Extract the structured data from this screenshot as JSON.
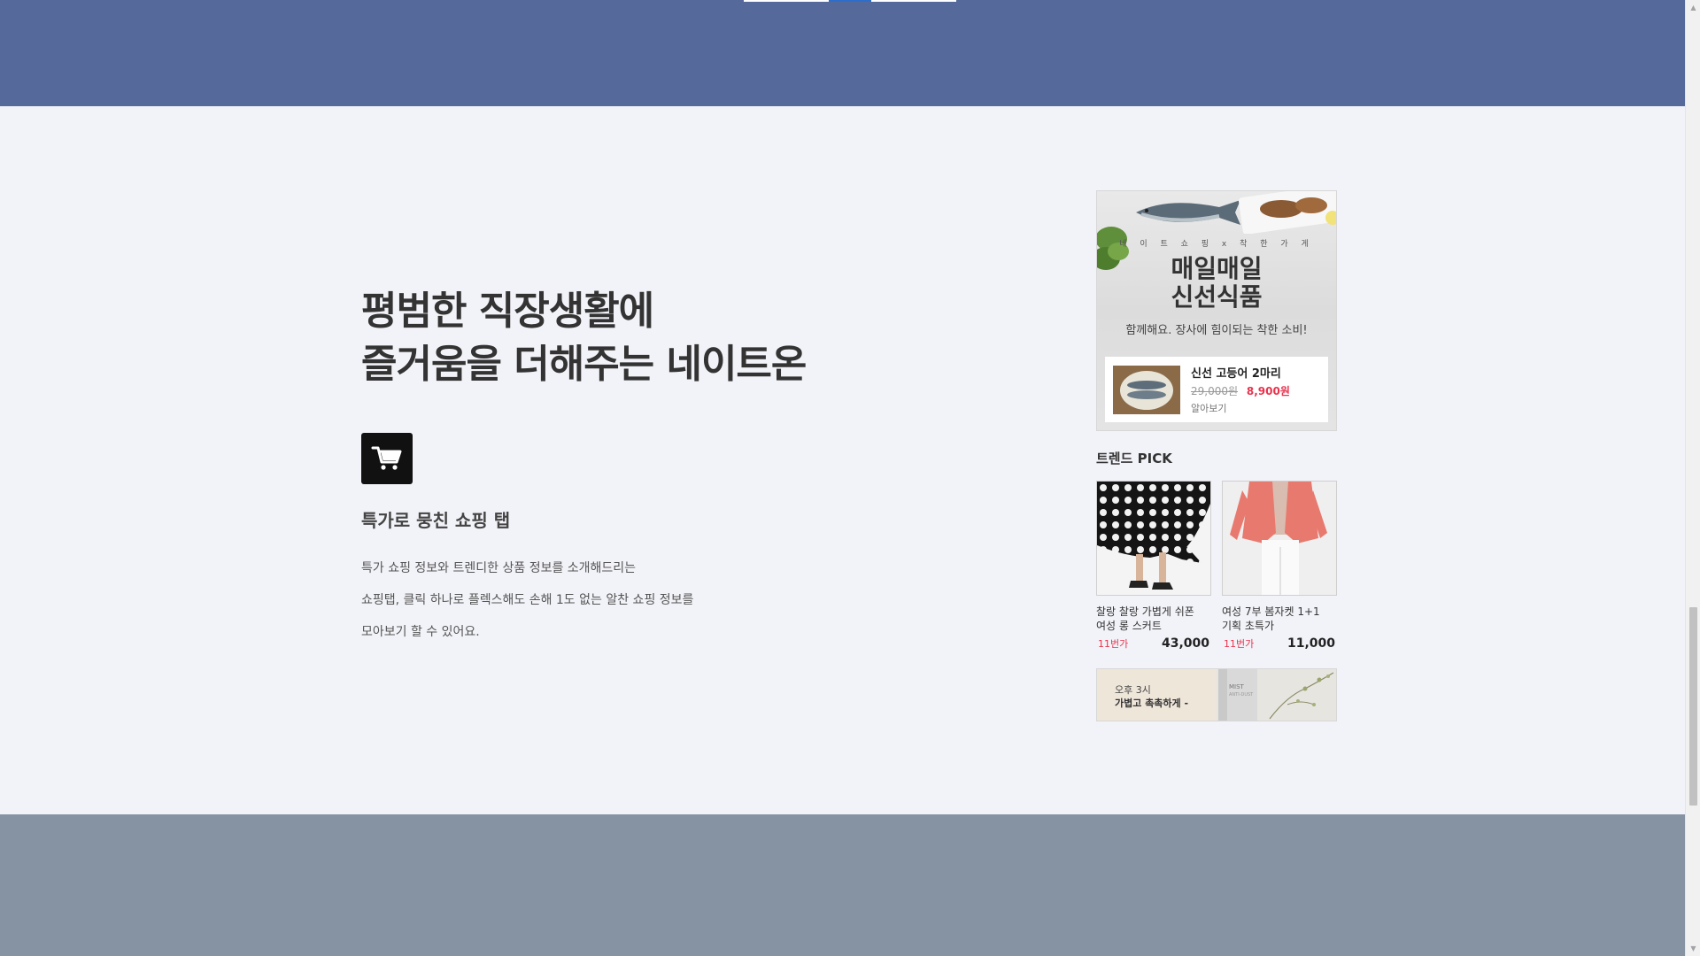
{
  "headline": {
    "line1": "평범한 직장생활에",
    "line2": "즐거움을 더해주는 네이트온"
  },
  "feature": {
    "icon": "cart-icon",
    "title": "특가로 뭉친 쇼핑 탭",
    "desc": [
      "특가 쇼핑 정보와 트렌디한 상품 정보를 소개해드리는",
      "쇼핑탭, 클릭 하나로 플렉스해도 손해 1도 없는 알찬 쇼핑 정보를",
      "모아보기 할 수 있어요."
    ]
  },
  "promo": {
    "subtitle": "네 이 트 쇼 핑 x 착 한 가 게",
    "title_line1": "매일매일",
    "title_line2": "신선식품",
    "tagline": "함께해요. 장사에 힘이되는 착한 소비!",
    "product": {
      "name": "신선 고등어 2마리",
      "old_price": "29,000원",
      "new_price": "8,900원",
      "link": "알아보기"
    }
  },
  "trend": {
    "title": "트렌드 PICK",
    "items": [
      {
        "name_line1": "찰랑 찰랑 가볍게 쉬폰",
        "name_line2": "여성 롱 스커트",
        "store": "11번가",
        "price": "43,000"
      },
      {
        "name_line1": "여성 7부 봄자켓 1+1",
        "name_line2": "기획 초특가",
        "store": "11번가",
        "price": "11,000"
      }
    ]
  },
  "banner": {
    "time": "오후 3시",
    "copy": "가볍고 촉촉하게 -",
    "product_label_1": "MIST",
    "product_label_2": "ANTI-DUST"
  },
  "colors": {
    "top_band": "#55699b",
    "page_bg": "#f2f3f8",
    "bottom_band": "#8693a3",
    "sale_red": "#e8344e",
    "slider_active": "#2d6ec8"
  },
  "slider": {
    "active_index": 1,
    "total": 3
  }
}
